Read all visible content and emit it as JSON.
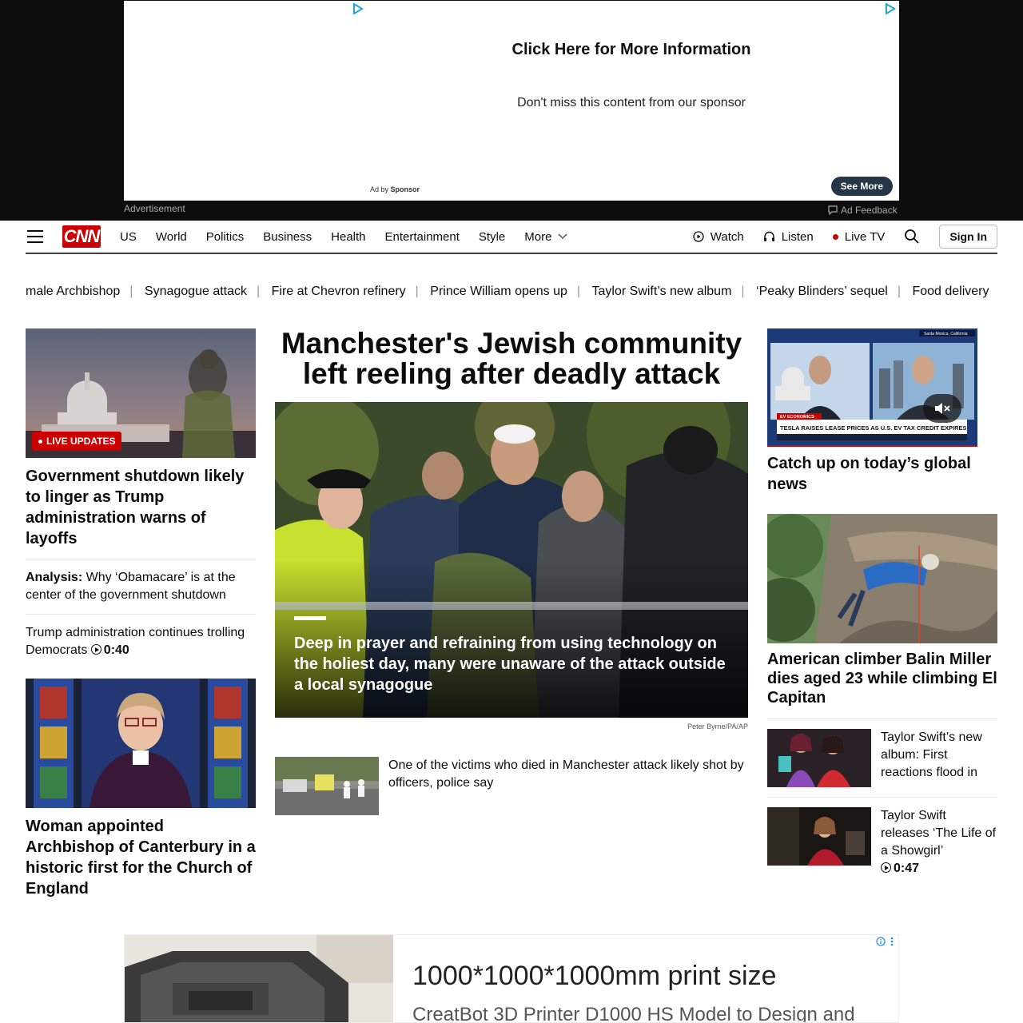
{
  "ad_top": {
    "title": "Click Here for More Information",
    "subtitle": "Don't miss this content from our sponsor",
    "ad_by_prefix": "Ad by",
    "ad_by_sponsor": "Sponsor",
    "button": "See More",
    "label_left": "Advertisement",
    "label_right": "Ad Feedback"
  },
  "header": {
    "logo": "CNN",
    "nav": [
      "US",
      "World",
      "Politics",
      "Business",
      "Health",
      "Entertainment",
      "Style",
      "More"
    ],
    "right": {
      "watch": "Watch",
      "listen": "Listen",
      "live_tv": "Live TV",
      "sign_in": "Sign In"
    }
  },
  "trending": [
    "male Archbishop",
    "Synagogue attack",
    "Fire at Chevron refinery",
    "Prince William opens up",
    "Taylor Swift’s new album",
    "‘Peaky Blinders’ sequel",
    "Food delivery"
  ],
  "left": {
    "badge": "LIVE UPDATES",
    "lead_headline": "Government shutdown likely to linger as Trump administration warns of layoffs",
    "analysis_label": "Analysis:",
    "analysis_text": " Why ‘Obamacare’ is at the center of the government shutdown",
    "video_text": "Trump administration continues trolling Democrats ",
    "video_duration": "0:40",
    "second_headline": "Woman appointed Archbishop of Canterbury in a historic first for the Church of England"
  },
  "center": {
    "title": "Manchester's Jewish community left reeling after deadly attack",
    "hero_caption": "Deep in prayer and refraining from using technology on the holiest day, many were unaware of the attack outside a local synagogue",
    "credit": "Peter Byrne/PA/AP",
    "related_text": "One of the victims who died in Manchester attack likely shot by officers, police say"
  },
  "right": {
    "video_headline": "Catch up on today’s global news",
    "video_ticker": "TESLA RAISES LEASE PRICES AS U.S. EV TAX CREDIT EXPIRES",
    "video_tag": "EV ECONOMICS",
    "video_location": "Santa Monica, California",
    "climber_headline": "American climber Balin Miller dies aged 23 while climbing El Capitan",
    "swift1_text": "Taylor Swift’s new album: First reactions flood in",
    "swift2_text": "Taylor Swift releases ‘The Life of a Showgirl’",
    "swift2_duration": "0:47"
  },
  "ad_bottom": {
    "headline": "1000*1000*1000mm print size",
    "subline": "CreatBot 3D Printer D1000 HS Model to Design and"
  },
  "colors": {
    "brand": "#cc0000",
    "ad_bg": "#0c0c0c",
    "see_more_bg": "#253746"
  }
}
